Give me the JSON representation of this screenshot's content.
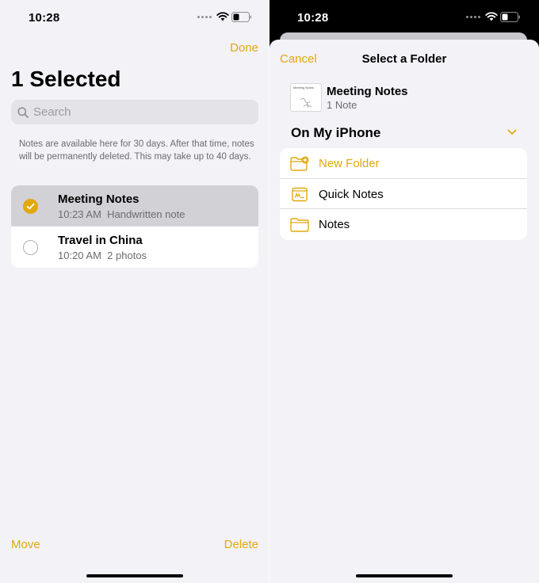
{
  "left": {
    "status": {
      "time": "10:28"
    },
    "done_label": "Done",
    "title": "1 Selected",
    "search": {
      "placeholder": "Search"
    },
    "info": "Notes are available here for 30 days. After that time, notes will be permanently deleted. This may take up to 40 days.",
    "notes": [
      {
        "title": "Meeting Notes",
        "time": "10:23 AM",
        "detail": "Handwritten note",
        "selected": true
      },
      {
        "title": "Travel in China",
        "time": "10:20 AM",
        "detail": "2 photos",
        "selected": false
      }
    ],
    "move_label": "Move",
    "delete_label": "Delete"
  },
  "right": {
    "status": {
      "time": "10:28"
    },
    "cancel_label": "Cancel",
    "sheet_title": "Select a Folder",
    "moving_note": {
      "title": "Meeting Notes",
      "count": "1 Note",
      "thumb_title": "Meeting Notes"
    },
    "section": "On My iPhone",
    "folders": [
      {
        "label": "New Folder",
        "icon": "new-folder-icon"
      },
      {
        "label": "Quick Notes",
        "icon": "quick-notes-icon"
      },
      {
        "label": "Notes",
        "icon": "folder-icon"
      }
    ]
  },
  "colors": {
    "accent": "#e3a80d",
    "background": "#f2f2f7"
  }
}
